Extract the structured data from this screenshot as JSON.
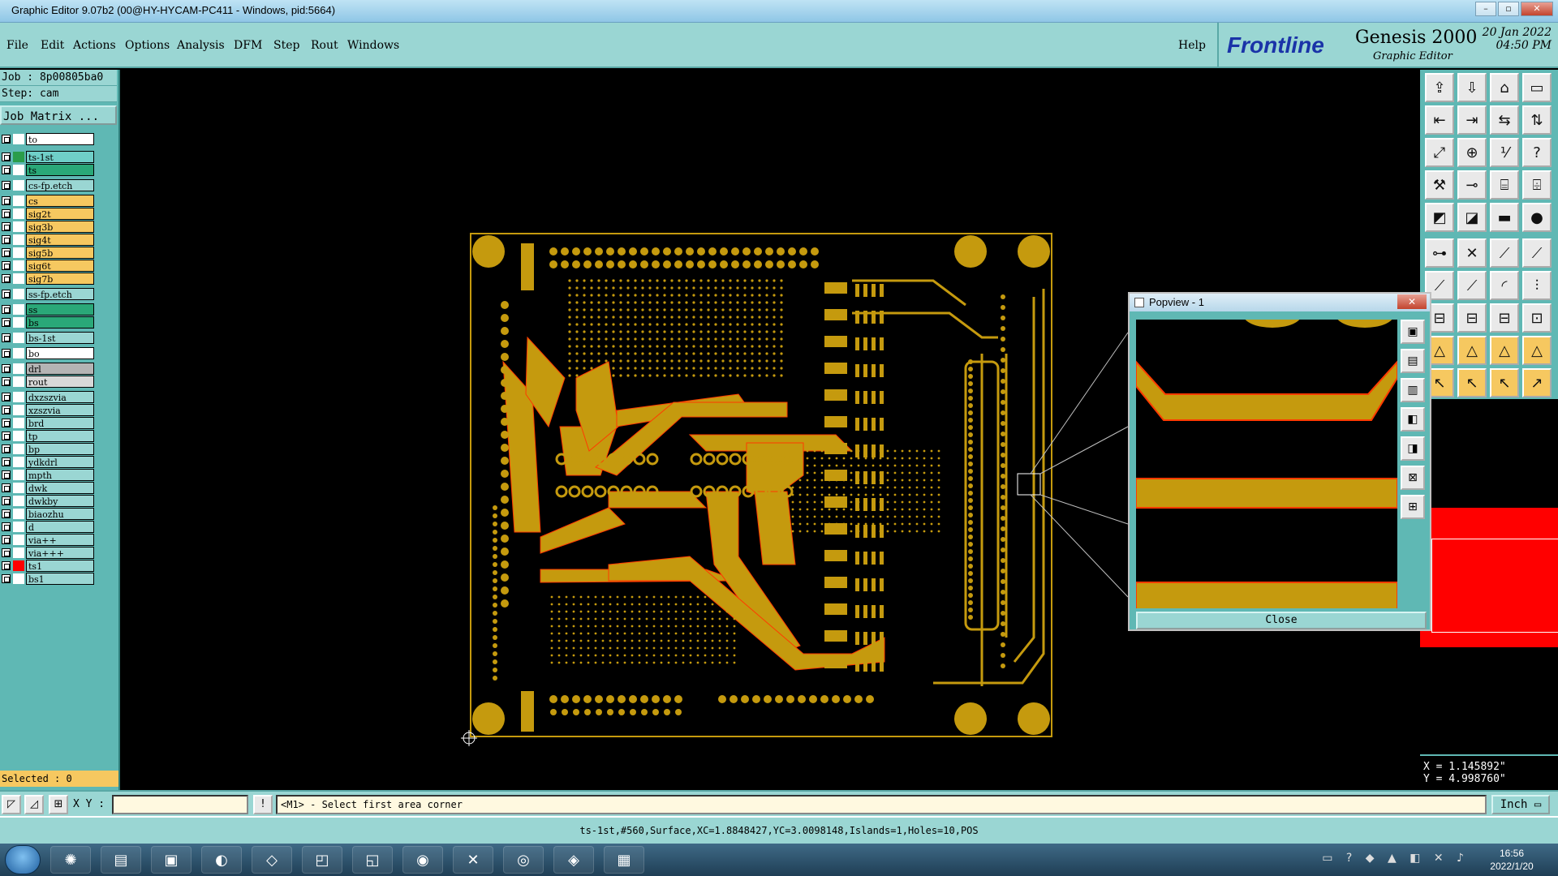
{
  "window": {
    "title": "Graphic Editor 9.07b2 (00@HY-HYCAM-PC411 - Windows, pid:5664)"
  },
  "menu": {
    "items": [
      "File",
      "Edit",
      "Actions",
      "Options",
      "Analysis",
      "DFM",
      "Step",
      "Rout",
      "Windows"
    ],
    "help": "Help"
  },
  "brand": {
    "logo": "Frontline",
    "product": "Genesis 2000",
    "subtitle": "Graphic Editor",
    "date": "20 Jan 2022",
    "time": "04:50 PM"
  },
  "job": {
    "job_line": "Job : 8p00805ba0",
    "step_line": "Step: cam",
    "matrix_button": "Job Matrix ..."
  },
  "layers": [
    {
      "name": "to",
      "color": "#ffffff",
      "swatch": "#ffffff"
    },
    {
      "name": "ts-1st",
      "color": "#6fcfc8",
      "swatch": "#2a9d4a",
      "active": true
    },
    {
      "name": "ts",
      "color": "#2aa878",
      "swatch": "#ffffff"
    },
    {
      "name": "cs-fp.etch",
      "color": "#9ad6d3",
      "swatch": "#ffffff"
    },
    {
      "name": "cs",
      "color": "#f6c860",
      "swatch": "#ffffff"
    },
    {
      "name": "sig2t",
      "color": "#f6c860",
      "swatch": "#ffffff"
    },
    {
      "name": "sig3b",
      "color": "#f6c860",
      "swatch": "#ffffff"
    },
    {
      "name": "sig4t",
      "color": "#f6c860",
      "swatch": "#ffffff"
    },
    {
      "name": "sig5b",
      "color": "#f6c860",
      "swatch": "#ffffff"
    },
    {
      "name": "sig6t",
      "color": "#f6c860",
      "swatch": "#ffffff"
    },
    {
      "name": "sig7b",
      "color": "#f6c860",
      "swatch": "#ffffff"
    },
    {
      "name": "ss-fp.etch",
      "color": "#9ad6d3",
      "swatch": "#ffffff"
    },
    {
      "name": "ss",
      "color": "#2aa878",
      "swatch": "#ffffff"
    },
    {
      "name": "bs",
      "color": "#2aa878",
      "swatch": "#ffffff"
    },
    {
      "name": "bs-1st",
      "color": "#9ad6d3",
      "swatch": "#ffffff"
    },
    {
      "name": "bo",
      "color": "#ffffff",
      "swatch": "#ffffff"
    },
    {
      "name": "drl",
      "color": "#b4b4b4",
      "swatch": "#ffffff"
    },
    {
      "name": "rout",
      "color": "#d8d8d8",
      "swatch": "#ffffff"
    },
    {
      "name": "dxzszvia",
      "color": "#9ad6d3",
      "swatch": "#ffffff"
    },
    {
      "name": "xzszvia",
      "color": "#9ad6d3",
      "swatch": "#ffffff"
    },
    {
      "name": "brd",
      "color": "#9ad6d3",
      "swatch": "#ffffff"
    },
    {
      "name": "tp",
      "color": "#9ad6d3",
      "swatch": "#ffffff"
    },
    {
      "name": "bp",
      "color": "#9ad6d3",
      "swatch": "#ffffff"
    },
    {
      "name": "ydkdrl",
      "color": "#9ad6d3",
      "swatch": "#ffffff"
    },
    {
      "name": "mpth",
      "color": "#9ad6d3",
      "swatch": "#ffffff"
    },
    {
      "name": "dwk",
      "color": "#9ad6d3",
      "swatch": "#ffffff"
    },
    {
      "name": "dwkby",
      "color": "#9ad6d3",
      "swatch": "#ffffff"
    },
    {
      "name": "biaozhu",
      "color": "#9ad6d3",
      "swatch": "#ffffff"
    },
    {
      "name": "d",
      "color": "#9ad6d3",
      "swatch": "#ffffff"
    },
    {
      "name": "via++",
      "color": "#9ad6d3",
      "swatch": "#ffffff"
    },
    {
      "name": "via+++",
      "color": "#9ad6d3",
      "swatch": "#ffffff"
    },
    {
      "name": "ts1",
      "color": "#9ad6d3",
      "swatch": "#ff0000"
    },
    {
      "name": "bs1",
      "color": "#9ad6d3",
      "swatch": "#ffffff"
    }
  ],
  "selected": "Selected : 0",
  "coords": {
    "x": "X = 1.145892\"",
    "y": "Y = 4.998760\""
  },
  "popview": {
    "title": "Popview - 1",
    "close_label": "Close",
    "close_x": "✕"
  },
  "command": {
    "xy_label": "X Y :",
    "xy_value": "",
    "prompt": "<M1> - Select first area corner",
    "units": "Inch"
  },
  "status": "ts-1st,#560,Surface,XC=1.8848427,YC=3.0098148,Islands=1,Holes=10,POS",
  "taskbar": {
    "time": "16:56",
    "date": "2022/1/20"
  },
  "colors": {
    "copper": "#c59a0e",
    "panel": "#5fb8b4",
    "bar": "#9ad6d3",
    "outline": "#ff3b00"
  }
}
